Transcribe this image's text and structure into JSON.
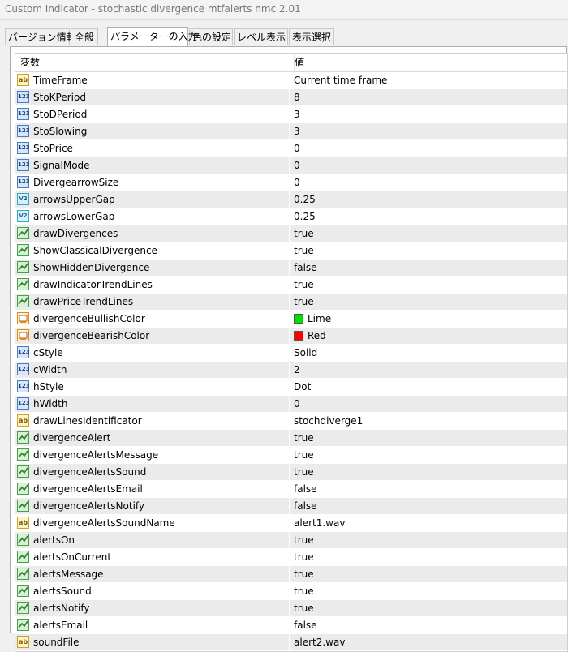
{
  "window": {
    "title": "Custom Indicator - stochastic divergence mtfalerts nmc 2.01"
  },
  "tabs": [
    {
      "label": "バージョン情報",
      "active": false
    },
    {
      "label": "全般",
      "active": false
    },
    {
      "label": "パラメーターの入力",
      "active": true
    },
    {
      "label": "色の設定",
      "active": false
    },
    {
      "label": "レベル表示",
      "active": false
    },
    {
      "label": "表示選択",
      "active": false
    }
  ],
  "grid": {
    "header": {
      "name": "変数",
      "value": "値"
    },
    "rows": [
      {
        "icon": "ab",
        "name": "TimeFrame",
        "value": "Current time frame"
      },
      {
        "icon": "int",
        "name": "StoKPeriod",
        "value": "8"
      },
      {
        "icon": "int",
        "name": "StoDPeriod",
        "value": "3"
      },
      {
        "icon": "int",
        "name": "StoSlowing",
        "value": "3"
      },
      {
        "icon": "int",
        "name": "StoPrice",
        "value": "0"
      },
      {
        "icon": "int",
        "name": "SignalMode",
        "value": "0"
      },
      {
        "icon": "int",
        "name": "DivergearrowSize",
        "value": "0"
      },
      {
        "icon": "dbl",
        "name": "arrowsUpperGap",
        "value": "0.25"
      },
      {
        "icon": "dbl",
        "name": "arrowsLowerGap",
        "value": "0.25"
      },
      {
        "icon": "bool",
        "name": "drawDivergences",
        "value": "true"
      },
      {
        "icon": "bool",
        "name": "ShowClassicalDivergence",
        "value": "true"
      },
      {
        "icon": "bool",
        "name": "ShowHiddenDivergence",
        "value": "false"
      },
      {
        "icon": "bool",
        "name": "drawIndicatorTrendLines",
        "value": "true"
      },
      {
        "icon": "bool",
        "name": "drawPriceTrendLines",
        "value": "true"
      },
      {
        "icon": "color",
        "name": "divergenceBullishColor",
        "value": "Lime",
        "swatch": "#00e000"
      },
      {
        "icon": "color",
        "name": "divergenceBearishColor",
        "value": "Red",
        "swatch": "#ff0000"
      },
      {
        "icon": "int",
        "name": "cStyle",
        "value": "Solid"
      },
      {
        "icon": "int",
        "name": "cWidth",
        "value": "2"
      },
      {
        "icon": "int",
        "name": "hStyle",
        "value": "Dot"
      },
      {
        "icon": "int",
        "name": "hWidth",
        "value": "0"
      },
      {
        "icon": "ab",
        "name": "drawLinesIdentificator",
        "value": "stochdiverge1"
      },
      {
        "icon": "bool",
        "name": "divergenceAlert",
        "value": "true"
      },
      {
        "icon": "bool",
        "name": "divergenceAlertsMessage",
        "value": "true"
      },
      {
        "icon": "bool",
        "name": "divergenceAlertsSound",
        "value": "true"
      },
      {
        "icon": "bool",
        "name": "divergenceAlertsEmail",
        "value": "false"
      },
      {
        "icon": "bool",
        "name": "divergenceAlertsNotify",
        "value": "false"
      },
      {
        "icon": "ab",
        "name": "divergenceAlertsSoundName",
        "value": "alert1.wav"
      },
      {
        "icon": "bool",
        "name": "alertsOn",
        "value": "true"
      },
      {
        "icon": "bool",
        "name": "alertsOnCurrent",
        "value": "true"
      },
      {
        "icon": "bool",
        "name": "alertsMessage",
        "value": "true"
      },
      {
        "icon": "bool",
        "name": "alertsSound",
        "value": "true"
      },
      {
        "icon": "bool",
        "name": "alertsNotify",
        "value": "true"
      },
      {
        "icon": "bool",
        "name": "alertsEmail",
        "value": "false"
      },
      {
        "icon": "ab",
        "name": "soundFile",
        "value": "alert2.wav"
      }
    ]
  }
}
